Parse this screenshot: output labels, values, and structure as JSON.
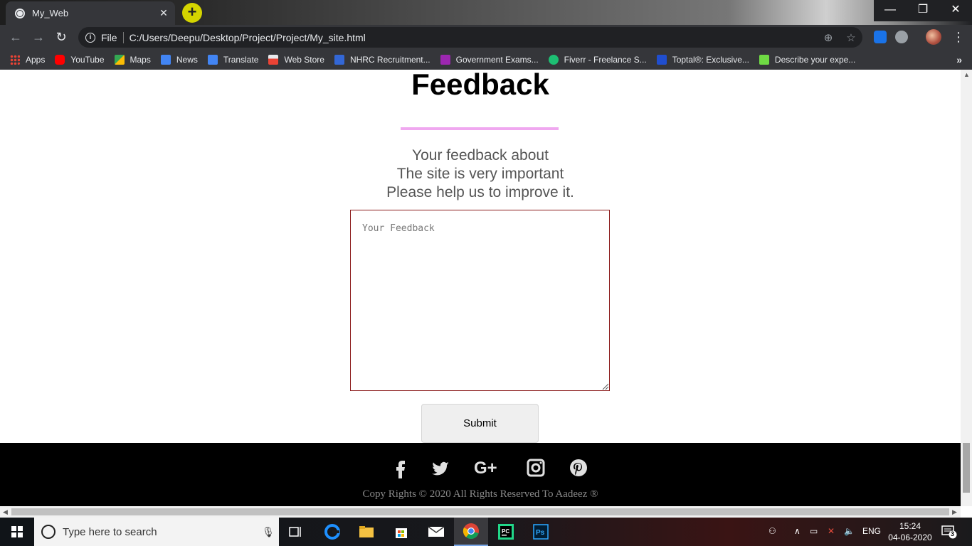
{
  "browser": {
    "tab_title": "My_Web",
    "tab_close": "✕",
    "new_tab": "+",
    "url_scheme_label": "File",
    "url": "C:/Users/Deepu/Desktop/Project/Project/My_site.html",
    "window_controls": {
      "minimize": "—",
      "restore": "❐",
      "close": "✕"
    },
    "bookmarks": [
      {
        "label": "Apps",
        "color": "#ea4335"
      },
      {
        "label": "YouTube",
        "color": "#ff0000"
      },
      {
        "label": "Maps",
        "color": "#34a853"
      },
      {
        "label": "News",
        "color": "#4285f4"
      },
      {
        "label": "Translate",
        "color": "#4285f4"
      },
      {
        "label": "Web Store",
        "color": "#e8eaed"
      },
      {
        "label": "NHRC Recruitment...",
        "color": "#3367d6"
      },
      {
        "label": "Government Exams...",
        "color": "#9c27b0"
      },
      {
        "label": "Fiverr - Freelance S...",
        "color": "#1dbf73"
      },
      {
        "label": "Toptal®: Exclusive...",
        "color": "#204ecf"
      },
      {
        "label": "Describe your expe...",
        "color": "#6fda44"
      }
    ],
    "bookmarks_more": "»"
  },
  "page": {
    "heading": "Feedback",
    "subtext_lines": [
      "Your feedback about",
      "The site is very important",
      "Please help us to improve it."
    ],
    "textarea_placeholder": "Your Feedback",
    "submit_label": "Submit",
    "copyright": "Copy Rights © 2020 All Rights Reserved To Aadeez ®",
    "accent_underline_color": "#f0a8f0",
    "social_icons": [
      "facebook-icon",
      "twitter-icon",
      "google-plus-icon",
      "instagram-icon",
      "pinterest-icon"
    ]
  },
  "taskbar": {
    "search_placeholder": "Type here to search",
    "language": "ENG",
    "time": "15:24",
    "date": "04-06-2020",
    "notification_count": "3"
  }
}
